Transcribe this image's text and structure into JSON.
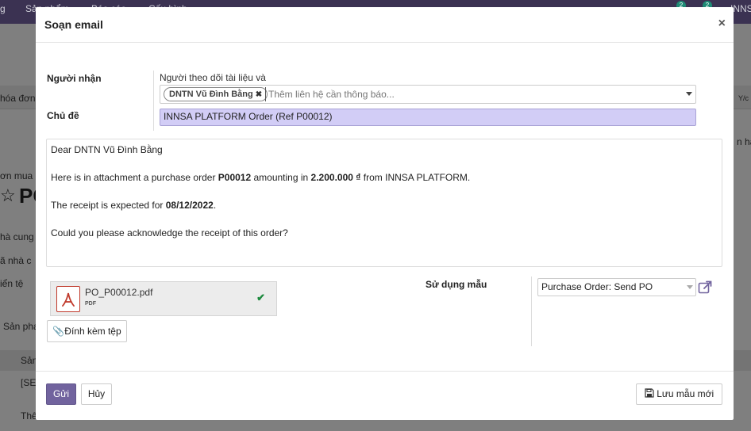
{
  "background": {
    "nav_items": [
      "g",
      "Sản phẩm",
      "Báo cáo",
      "Cấu hình"
    ],
    "company": "INNS",
    "badge_counts": [
      "2",
      "2"
    ],
    "strip_left": "hóa đơn",
    "strip_right": "Y/c",
    "side_right": "n hà",
    "breadcrumb": "ơn mua",
    "title": "PC",
    "fields": [
      "hà cung",
      "ã nhà c",
      "iển tệ"
    ],
    "tab_products": "Sản pha",
    "table_head": "Sản",
    "row1": "[SE",
    "row2": "Thê"
  },
  "modal": {
    "title": "Soạn email",
    "close": "×",
    "recipients_label": "Người nhận",
    "followers_note": "Người theo dõi tài liệu và",
    "recipient_tag": "DNTN Vũ Đình Bằng",
    "recipient_placeholder": "Thêm liên hệ cần thông báo...",
    "subject_label": "Chủ đề",
    "subject": "INNSA PLATFORM Order (Ref P00012)",
    "body": {
      "greeting": "Dear DNTN Vũ Đình Bằng",
      "line1_pre": "Here is in attachment a purchase order ",
      "po_number": "P00012",
      "line1_mid": " amounting in ",
      "amount": "2.200.000 ₫",
      "line1_post": " from INNSA PLATFORM.",
      "line2_pre": "The receipt is expected for ",
      "date": "08/12/2022",
      "line2_post": ".",
      "line3": "Could you please acknowledge the receipt of this order?"
    },
    "attachment": {
      "file_name": "PO_P00012.pdf",
      "file_type": "PDF"
    },
    "attach_button": "Đính kèm tệp",
    "template_label": "Sử dụng mẫu",
    "template_value": "Purchase Order: Send PO",
    "send_button": "Gửi",
    "cancel_button": "Hủy",
    "save_template_button": "Lưu mẫu mới"
  },
  "colors": {
    "primary": "#71639e",
    "subject_bg": "#d2cdf6",
    "topbar": "#3b3252"
  }
}
